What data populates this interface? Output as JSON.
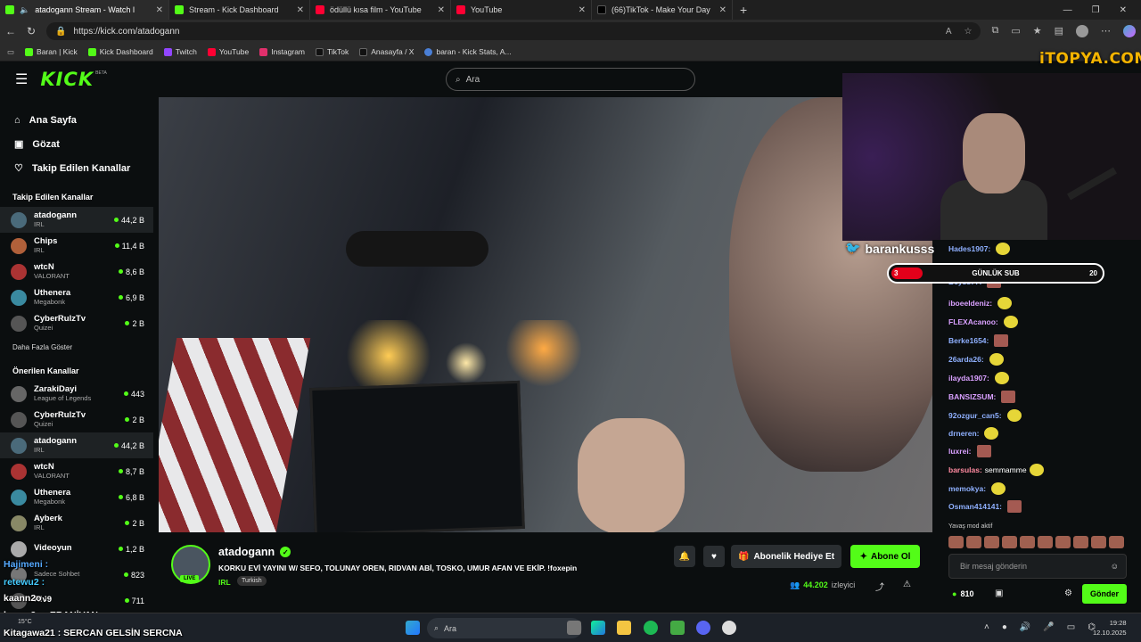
{
  "browser": {
    "tabs": [
      {
        "label": "atadogann Stream - Watch l",
        "color": "#53fc18"
      },
      {
        "label": "Stream - Kick Dashboard",
        "color": "#53fc18"
      },
      {
        "label": "ödüllü kısa film - YouTube",
        "color": "#ff0033"
      },
      {
        "label": "YouTube",
        "color": "#ff0033"
      },
      {
        "label": "(66)TikTok - Make Your Day",
        "color": "#222222"
      }
    ],
    "url": "https://kick.com/atadogann",
    "bookmarks": [
      {
        "label": "Baran | Kick",
        "color": "#53fc18"
      },
      {
        "label": "Kick Dashboard",
        "color": "#53fc18"
      },
      {
        "label": "Twitch",
        "color": "#9146ff"
      },
      {
        "label": "YouTube",
        "color": "#ff0033"
      },
      {
        "label": "Instagram",
        "color": "#e1306c"
      },
      {
        "label": "TikTok",
        "color": "#111111"
      },
      {
        "label": "Anasayfa / X",
        "color": "#111111"
      },
      {
        "label": "baran - Kick Stats, A...",
        "color": "#4a7fd6"
      }
    ]
  },
  "header": {
    "logo": "KICK",
    "beta": "BETA",
    "search_placeholder": "Ara"
  },
  "nav": [
    {
      "label": "Ana Sayfa",
      "icon": "home-icon"
    },
    {
      "label": "Gözat",
      "icon": "browse-icon"
    },
    {
      "label": "Takip Edilen Kanallar",
      "icon": "heart-icon"
    }
  ],
  "followed": {
    "title": "Takip Edilen Kanallar",
    "channels": [
      {
        "name": "atadogann",
        "cat": "IRL",
        "viewers": "44,2 B",
        "color": "#4a6a7a"
      },
      {
        "name": "Chips",
        "cat": "IRL",
        "viewers": "11,4 B",
        "color": "#b0603a"
      },
      {
        "name": "wtcN",
        "cat": "VALORANT",
        "viewers": "8,6 B",
        "color": "#a33"
      },
      {
        "name": "Uthenera",
        "cat": "Megabonk",
        "viewers": "6,9 B",
        "color": "#3a8aa0"
      },
      {
        "name": "CyberRulzTv",
        "cat": "Quizei",
        "viewers": "2 B",
        "color": "#555"
      }
    ],
    "more": "Daha Fazla Göster"
  },
  "suggested": {
    "title": "Önerilen Kanallar",
    "channels": [
      {
        "name": "ZarakiDayi",
        "cat": "League of Legends",
        "viewers": "443",
        "color": "#666"
      },
      {
        "name": "CyberRulzTv",
        "cat": "Quizei",
        "viewers": "2 B",
        "color": "#555"
      },
      {
        "name": "atadogann",
        "cat": "IRL",
        "viewers": "44,2 B",
        "color": "#4a6a7a"
      },
      {
        "name": "wtcN",
        "cat": "VALORANT",
        "viewers": "8,7 B",
        "color": "#a33"
      },
      {
        "name": "Uthenera",
        "cat": "Megabonk",
        "viewers": "6,8 B",
        "color": "#3a8aa0"
      },
      {
        "name": "Ayberk",
        "cat": "IRL",
        "viewers": "2 B",
        "color": "#886"
      },
      {
        "name": "Videoyun",
        "cat": "",
        "viewers": "1,2 B",
        "color": "#aaa"
      },
      {
        "name": "",
        "cat": "Sadece Sohbet",
        "viewers": "823",
        "color": "#777"
      },
      {
        "name": "Riv9",
        "cat": "",
        "viewers": "711",
        "color": "#555"
      }
    ]
  },
  "overlay": {
    "itopya": "iTOPYA.COM",
    "twitter_name": "barankusss",
    "sub_goal": {
      "title": "GÜNLÜK SUB",
      "current": "3",
      "target": "20",
      "fraction": 0.15
    }
  },
  "chat": {
    "messages": [
      {
        "user": "Hades1907:",
        "text": "",
        "color": "#8fb0ff"
      },
      {
        "user": "Beyss77:",
        "text": "",
        "color": "#8fb0ff"
      },
      {
        "user": "iboeeldeniz:",
        "text": "",
        "color": "#d9a0ff"
      },
      {
        "user": "FLEXAcanoo:",
        "text": "",
        "color": "#d9a0ff"
      },
      {
        "user": "Berke1654:",
        "text": "",
        "color": "#8fb0ff"
      },
      {
        "user": "26arda26:",
        "text": "",
        "color": "#8fb0ff"
      },
      {
        "user": "ilayda1907:",
        "text": "",
        "color": "#d9a0ff"
      },
      {
        "user": "BANSIZSUM:",
        "text": "",
        "color": "#d9a0ff"
      },
      {
        "user": "92ozgur_can5:",
        "text": "",
        "color": "#8fb0ff"
      },
      {
        "user": "drneren:",
        "text": "",
        "color": "#8fb0ff"
      },
      {
        "user": "luxrei:",
        "text": "",
        "color": "#d9a0ff"
      },
      {
        "user": "barsulas:",
        "text": "semmamme",
        "color": "#ff8aa0"
      },
      {
        "user": "memokya:",
        "text": "",
        "color": "#8fb0ff"
      },
      {
        "user": "Osman414141:",
        "text": "",
        "color": "#8fb0ff"
      }
    ],
    "slow_mode": "Yavaş mod aktif",
    "input_placeholder": "Bir mesaj gönderin",
    "points": "810",
    "send": "Gönder"
  },
  "stream": {
    "name": "atadogann",
    "live": "LIVE",
    "title": "KORKU EVİ YAYINI W/  SEFO, TOLUNAY OREN, RIDVAN ABİ, TOSKO, UMUR AFAN VE EKİP. !foxepin",
    "category": "IRL",
    "tag": "Turkish",
    "gift": "Abonelik Hediye Et",
    "subscribe": "Abone Ol",
    "viewers": "44.202",
    "viewers_label": "izleyici"
  },
  "overlay_chat": [
    {
      "text": "Hajimeni :"
    },
    {
      "text": "retewu2 :"
    },
    {
      "text": "kaann2o :"
    },
    {
      "text": "kaann2o : EBANİVAN"
    },
    {
      "text": "Kitagawa21 : SERCAN GELSİN SERCNA"
    }
  ],
  "taskbar": {
    "search": "Ara",
    "time": "19:28",
    "date": "12.10.2025",
    "weather": "15°C"
  }
}
